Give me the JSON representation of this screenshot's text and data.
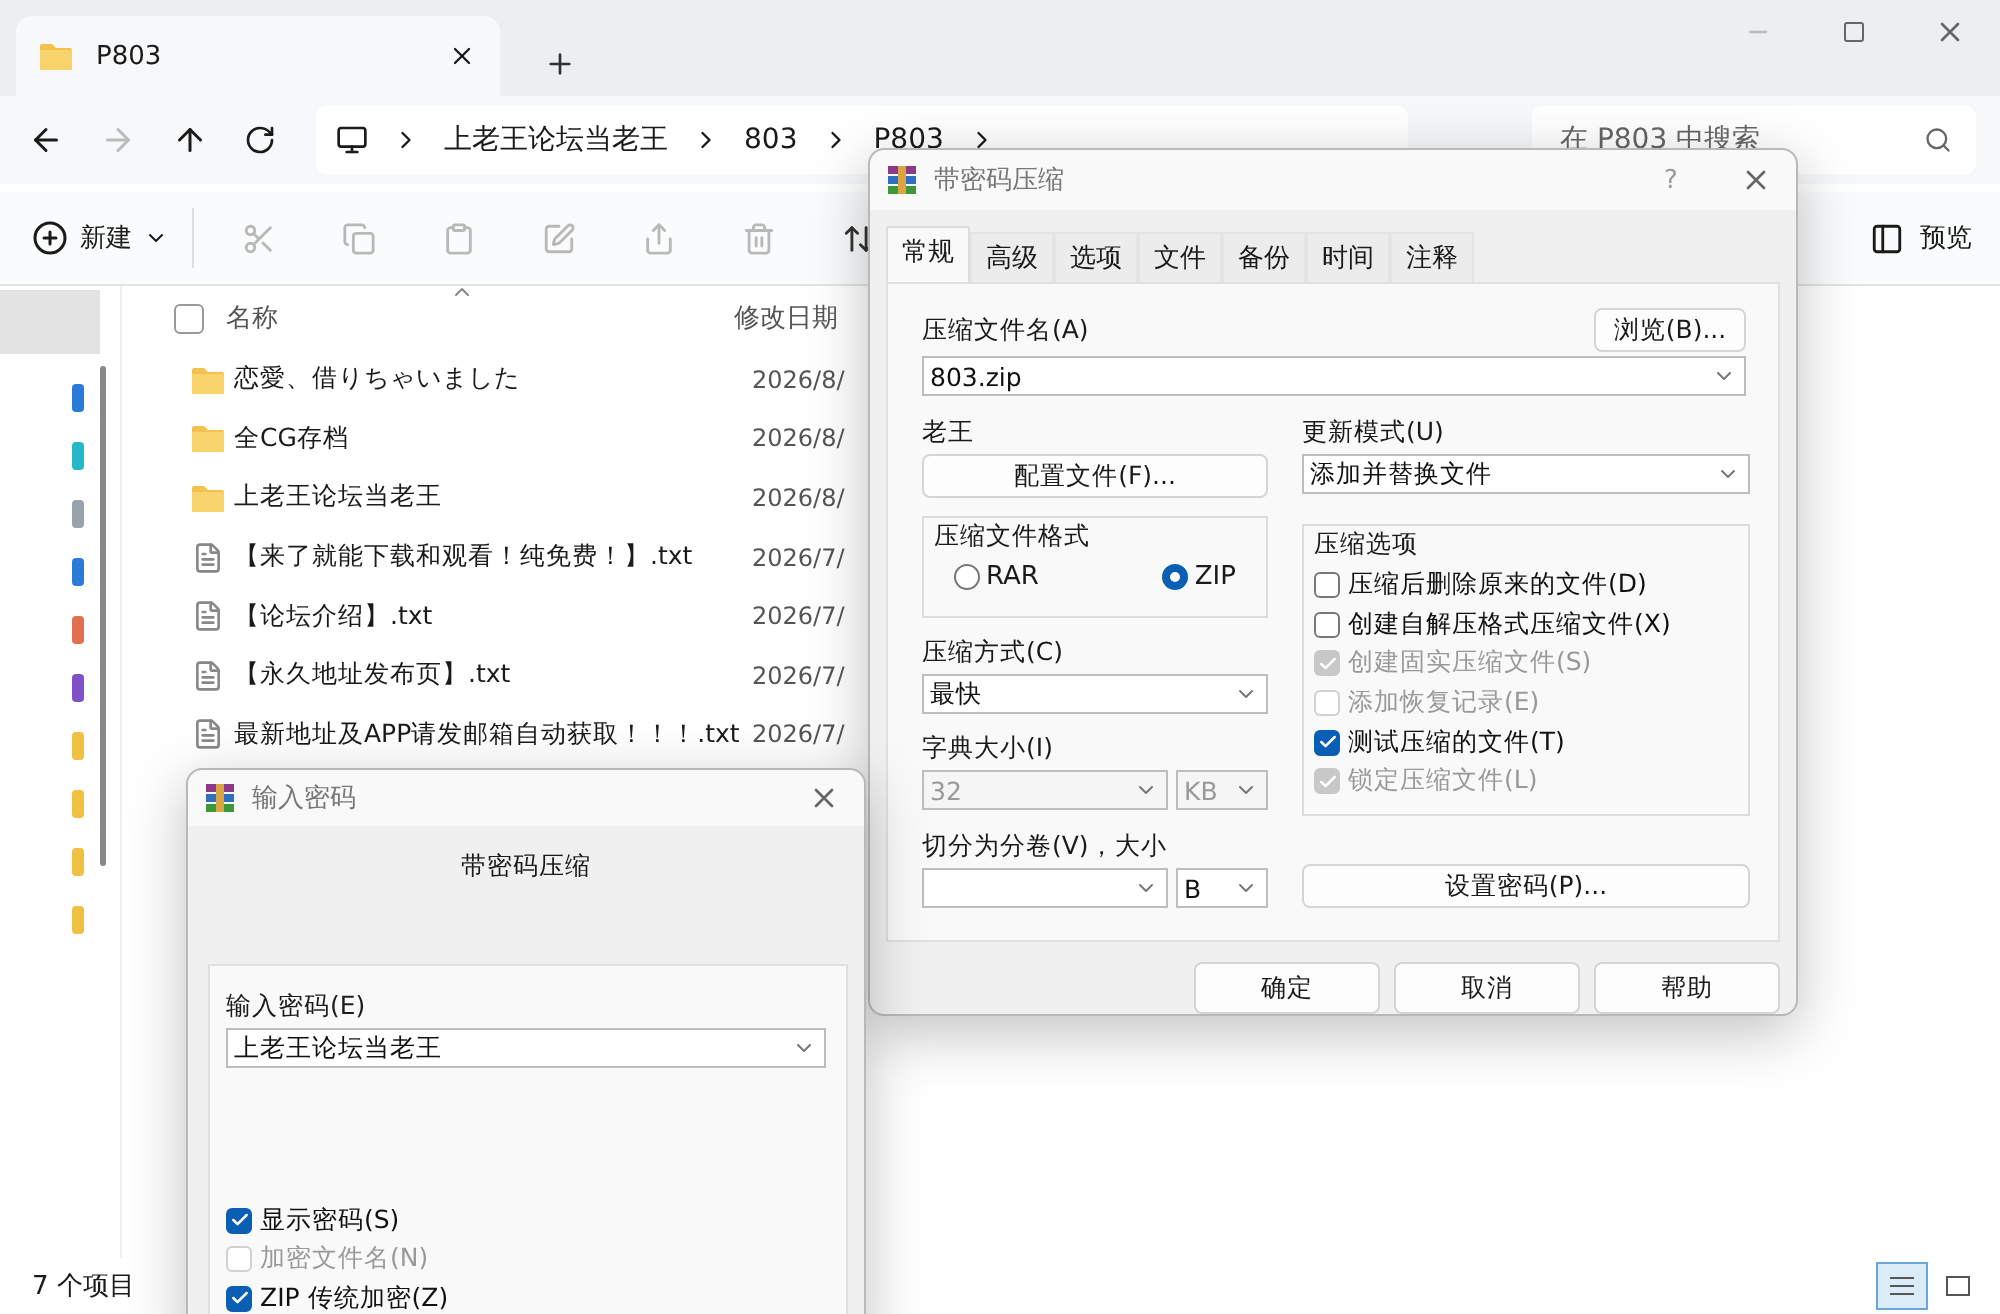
{
  "explorer": {
    "tab_title": "P803",
    "breadcrumb": [
      "上老王论坛当老王",
      "803",
      "P803"
    ],
    "search": {
      "placeholder": "在 P803 中搜索"
    },
    "toolbar": {
      "new_label": "新建",
      "preview_label": "预览"
    },
    "columns": [
      "名称",
      "修改日期"
    ],
    "files": [
      {
        "kind": "folder",
        "name": "恋愛、借りちゃいました",
        "date": "2026/8/"
      },
      {
        "kind": "folder",
        "name": "全CG存档",
        "date": "2026/8/"
      },
      {
        "kind": "folder",
        "name": "上老王论坛当老王",
        "date": "2026/8/"
      },
      {
        "kind": "text",
        "name": "【来了就能下载和观看！纯免费！】.txt",
        "date": "2026/7/"
      },
      {
        "kind": "text",
        "name": "【论坛介绍】.txt",
        "date": "2026/7/"
      },
      {
        "kind": "text",
        "name": "【永久地址发布页】.txt",
        "date": "2026/7/"
      },
      {
        "kind": "text",
        "name": "最新地址及APP请发邮箱自动获取！！！.txt",
        "date": "2026/7/"
      }
    ],
    "select_all": {
      "checked": false
    },
    "status": "7 个项目",
    "view_modes": [
      {
        "kind": "details",
        "selected": true
      },
      {
        "kind": "tiles",
        "selected": false
      }
    ]
  },
  "archive_dialog": {
    "title": "带密码压缩",
    "help": "?",
    "tabs": [
      {
        "label": "常规",
        "selected": true
      },
      {
        "label": "高级",
        "selected": false
      },
      {
        "label": "选项",
        "selected": false
      },
      {
        "label": "文件",
        "selected": false
      },
      {
        "label": "备份",
        "selected": false
      },
      {
        "label": "时间",
        "selected": false
      },
      {
        "label": "注释",
        "selected": false
      }
    ],
    "archive_name_label": "压缩文件名(A)",
    "browse_button": "浏览(B)...",
    "archive_name": "803.zip",
    "profile_label": "老王",
    "profile_button": "配置文件(F)...",
    "update_mode_label": "更新模式(U)",
    "update_mode": "添加并替换文件",
    "format_label": "压缩文件格式",
    "formats": [
      {
        "label": "RAR",
        "selected": false
      },
      {
        "label": "ZIP",
        "selected": true
      }
    ],
    "method_label": "压缩方式(C)",
    "method": "最快",
    "dict_label": "字典大小(I)",
    "dict_size": "32",
    "dict_unit": "KB",
    "dict_disabled": true,
    "split_label": "切分为分卷(V)，大小",
    "split_unit": "B",
    "options_label": "压缩选项",
    "options": [
      {
        "label": "压缩后删除原来的文件(D)",
        "checked": false,
        "disabled": false
      },
      {
        "label": "创建自解压格式压缩文件(X)",
        "checked": false,
        "disabled": false
      },
      {
        "label": "创建固实压缩文件(S)",
        "checked": true,
        "disabled": true
      },
      {
        "label": "添加恢复记录(E)",
        "checked": false,
        "disabled": true
      },
      {
        "label": "测试压缩的文件(T)",
        "checked": true,
        "disabled": false
      },
      {
        "label": "锁定压缩文件(L)",
        "checked": true,
        "disabled": true
      }
    ],
    "password_button": "设置密码(P)...",
    "buttons": [
      "确定",
      "取消",
      "帮助"
    ]
  },
  "password_dialog": {
    "title": "输入密码",
    "heading": "带密码压缩",
    "password_label": "输入密码(E)",
    "password": "上老王论坛当老王",
    "options": [
      {
        "label": "显示密码(S)",
        "checked": true,
        "disabled": false
      },
      {
        "label": "加密文件名(N)",
        "checked": false,
        "disabled": true
      },
      {
        "label": "ZIP 传统加密(Z)",
        "checked": true,
        "disabled": false
      }
    ]
  }
}
